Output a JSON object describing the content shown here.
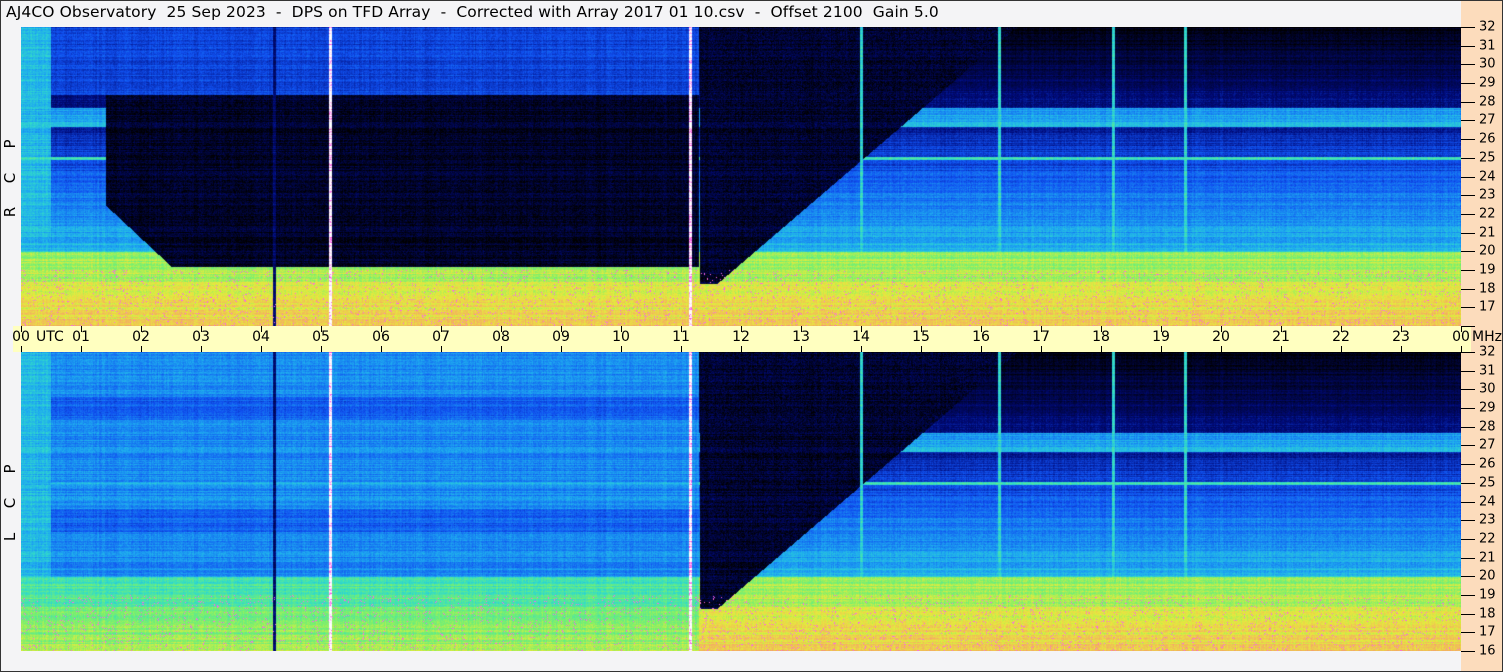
{
  "title": "AJ4CO Observatory  25 Sep 2023  -  DPS on TFD Array  -  Corrected with Array 2017 01 10.csv  -  Offset 2100  Gain 5.0",
  "panels": [
    {
      "letters": [
        "R",
        "C",
        "P"
      ]
    },
    {
      "letters": [
        "L",
        "C",
        "P"
      ]
    }
  ],
  "time_unit": "UTC",
  "freq_unit": "MHz",
  "colors": {
    "time_band": "#ffffc0",
    "scale_bg": "#fcdcbc",
    "bg": "#f4f4f6"
  },
  "chart_data": {
    "type": "heatmap",
    "title": "AJ4CO Observatory  25 Sep 2023  -  DPS on TFD Array",
    "xlabel": "UTC",
    "ylabel": "MHz",
    "x_ticks": [
      "00",
      "01",
      "02",
      "03",
      "04",
      "05",
      "06",
      "07",
      "08",
      "09",
      "10",
      "11",
      "12",
      "13",
      "14",
      "15",
      "16",
      "17",
      "18",
      "19",
      "20",
      "21",
      "22",
      "23",
      "00"
    ],
    "y_ticks": [
      "32",
      "31",
      "30",
      "29",
      "28",
      "27",
      "26",
      "25",
      "24",
      "23",
      "22",
      "21",
      "20",
      "19",
      "18",
      "17",
      "16"
    ],
    "xlim": [
      0,
      24
    ],
    "ylim": [
      16,
      32
    ],
    "series": [
      {
        "name": "RCP",
        "night_quiet_hours": [
          1.5,
          11.3
        ]
      },
      {
        "name": "LCP",
        "night_quiet_hours": [
          11.3,
          15.5
        ]
      }
    ]
  }
}
